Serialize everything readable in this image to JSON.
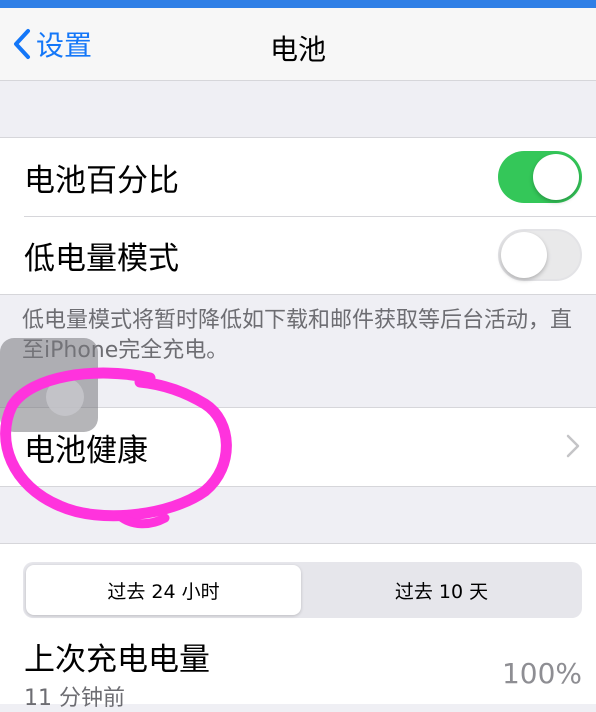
{
  "nav": {
    "back_label": "设置",
    "title": "电池"
  },
  "settings": {
    "battery_percentage": {
      "label": "电池百分比",
      "enabled": true
    },
    "low_power_mode": {
      "label": "低电量模式",
      "enabled": false
    },
    "low_power_footnote": "低电量模式将暂时降低如下载和邮件获取等后台活动，直至iPhone完全充电。"
  },
  "battery_health": {
    "label": "电池健康"
  },
  "usage_tabs": {
    "items": [
      "过去 24 小时",
      "过去 10 天"
    ],
    "selected": "过去 24 小时"
  },
  "last_charge": {
    "label": "上次充电电量",
    "value": "100%",
    "subtitle": "11 分钟前"
  },
  "colors": {
    "accent": "#1477f8",
    "toggle_on": "#34c759",
    "highlight_circle": "#ff33dd"
  }
}
